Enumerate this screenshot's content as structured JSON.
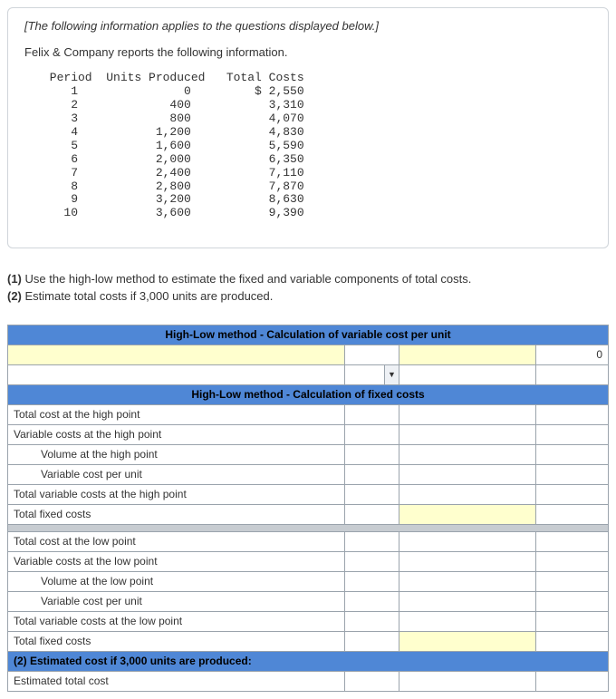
{
  "intro": {
    "note": "[The following information applies to the questions displayed below.]",
    "lead": "Felix & Company reports the following information."
  },
  "dataTable": {
    "hPeriod": "Period",
    "hUnits": "Units Produced",
    "hCosts": "Total Costs",
    "rows": [
      {
        "p": "1",
        "u": "0",
        "c": "$ 2,550"
      },
      {
        "p": "2",
        "u": "400",
        "c": "3,310"
      },
      {
        "p": "3",
        "u": "800",
        "c": "4,070"
      },
      {
        "p": "4",
        "u": "1,200",
        "c": "4,830"
      },
      {
        "p": "5",
        "u": "1,600",
        "c": "5,590"
      },
      {
        "p": "6",
        "u": "2,000",
        "c": "6,350"
      },
      {
        "p": "7",
        "u": "2,400",
        "c": "7,110"
      },
      {
        "p": "8",
        "u": "2,800",
        "c": "7,870"
      },
      {
        "p": "9",
        "u": "3,200",
        "c": "8,630"
      },
      {
        "p": "10",
        "u": "3,600",
        "c": "9,390"
      }
    ]
  },
  "q": {
    "q1b": "(1) ",
    "q1": "Use the high-low method to estimate the fixed and variable components of total costs.",
    "q2b": "(2) ",
    "q2": "Estimate total costs if 3,000 units are produced."
  },
  "calc": {
    "hdrVar": "High-Low method - Calculation of variable cost per unit",
    "zero": "0",
    "hdrFixed": "High-Low method - Calculation of fixed costs",
    "r1": "Total cost at the high point",
    "r2": "Variable costs at the high point",
    "r3": "Volume at the high point",
    "r4": "Variable cost per unit",
    "r5": "Total variable costs at the high point",
    "r6": "Total fixed costs",
    "r7": "Total cost at the low point",
    "r8": "Variable costs at the low point",
    "r9": "Volume at the low point",
    "r10": "Variable cost per unit",
    "r11": "Total variable costs at the low point",
    "r12": "Total fixed costs",
    "r13": "(2) Estimated cost if 3,000 units are produced:",
    "r14": "Estimated total cost"
  }
}
